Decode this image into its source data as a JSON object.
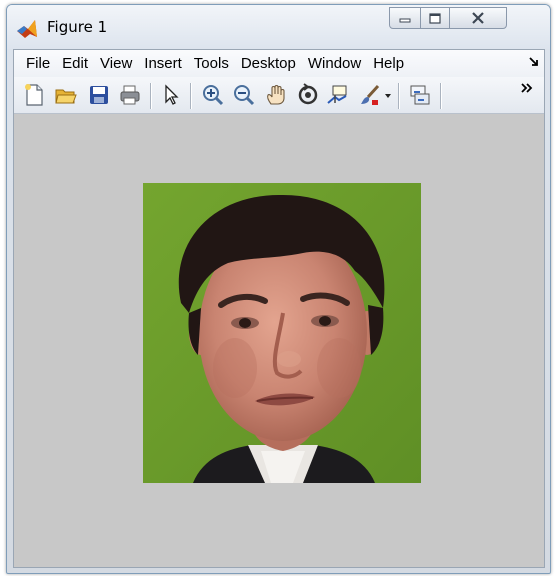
{
  "window": {
    "title": "Figure 1",
    "app_icon": "matlab-logo-icon",
    "controls": [
      "minimize-icon",
      "maximize-icon",
      "close-icon"
    ]
  },
  "menubar": {
    "items": [
      "File",
      "Edit",
      "View",
      "Insert",
      "Tools",
      "Desktop",
      "Window",
      "Help"
    ],
    "overflow_icon": "menu-overflow-arrow-icon"
  },
  "toolbar": {
    "buttons": [
      "new-figure-icon",
      "open-file-icon",
      "save-icon",
      "print-icon",
      "edit-plot-arrow-icon",
      "zoom-in-icon",
      "zoom-out-icon",
      "pan-hand-icon",
      "rotate-3d-icon",
      "data-cursor-icon",
      "brush-icon",
      "brush-dropdown-icon",
      "link-plot-icon"
    ],
    "overflow_icon": "toolbar-overflow-icon"
  },
  "content": {
    "image": "face-photo",
    "colors": {
      "figure_background": "#c8c8c8",
      "photo_background": "#6fa12c"
    }
  }
}
